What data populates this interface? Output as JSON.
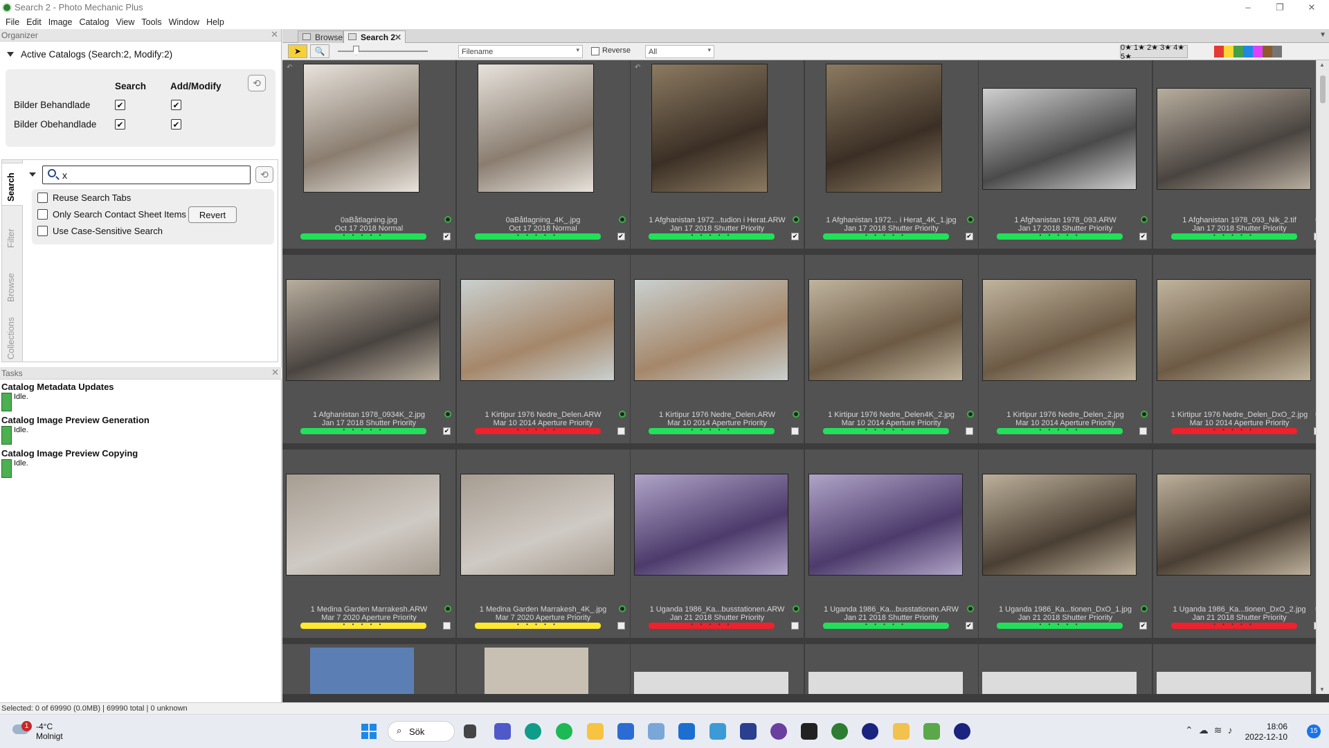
{
  "window": {
    "title": "Search 2 - Photo Mechanic Plus",
    "minimize": "–",
    "restore": "❐",
    "close": "✕"
  },
  "menu": [
    "File",
    "Edit",
    "Image",
    "Catalog",
    "View",
    "Tools",
    "Window",
    "Help"
  ],
  "organizer": {
    "header": "Organizer",
    "active_catalogs": "Active Catalogs (Search:2, Modify:2)",
    "col_search": "Search",
    "col_modify": "Add/Modify",
    "catalogs": [
      {
        "name": "Bilder Behandlade",
        "search": true,
        "modify": true
      },
      {
        "name": "Bilder Obehandlade",
        "search": true,
        "modify": true
      }
    ]
  },
  "side_tabs": [
    "Search",
    "Filter",
    "Browse",
    "Collections"
  ],
  "search": {
    "query": "x",
    "options": [
      {
        "label": "Reuse Search Tabs",
        "checked": false
      },
      {
        "label": "Only Search Contact Sheet Items",
        "checked": false
      },
      {
        "label": "Use Case-Sensitive Search",
        "checked": false
      }
    ],
    "revert_label": "Revert"
  },
  "tasks": {
    "header": "Tasks",
    "items": [
      {
        "title": "Catalog Metadata Updates",
        "status": "Idle."
      },
      {
        "title": "Catalog Image Preview Generation",
        "status": "Idle."
      },
      {
        "title": "Catalog Image Preview Copying",
        "status": "Idle."
      }
    ]
  },
  "tabs": [
    {
      "label": "Browse",
      "active": false
    },
    {
      "label": "Search 2",
      "active": true,
      "close": "✕"
    }
  ],
  "toolbar": {
    "sort_field": "Filename",
    "reverse_label": "Reverse",
    "filter_value": "All",
    "stars": "0★ 1★ 2★ 3★ 4★ 5★",
    "color_labels": [
      "#e53935",
      "#fdd835",
      "#43a047",
      "#1e88e5",
      "#e040fb",
      "#8e5a2b",
      "#757575"
    ]
  },
  "thumbnails": [
    {
      "caption1": "0aBåtlagning.jpg",
      "caption2": "Oct 17 2018 Normal",
      "label": "green",
      "tagged": true
    },
    {
      "caption1": "0aBåtlagning_4K_.jpg",
      "caption2": "Oct 17 2018 Normal",
      "label": "green",
      "tagged": true
    },
    {
      "caption1": "1 Afghanistan 1972...tudion i Herat.ARW",
      "caption2": "Jan 17 2018 Shutter Priority",
      "label": "green",
      "tagged": true
    },
    {
      "caption1": "1 Afghanistan 1972... i Herat_4K_1.jpg",
      "caption2": "Jan 17 2018 Shutter Priority",
      "label": "green",
      "tagged": true
    },
    {
      "caption1": "1 Afghanistan 1978_093.ARW",
      "caption2": "Jan 17 2018 Shutter Priority",
      "label": "green",
      "tagged": true
    },
    {
      "caption1": "1 Afghanistan 1978_093_Nik_2.tif",
      "caption2": "Jan 17 2018 Shutter Priority",
      "label": "green",
      "tagged": false
    },
    {
      "caption1": "1 Afghanistan 1978_0934K_2.jpg",
      "caption2": "Jan 17 2018 Shutter Priority",
      "label": "green",
      "tagged": true
    },
    {
      "caption1": "1 Kirtipur 1976 Nedre_Delen.ARW",
      "caption2": "Mar 10 2014 Aperture Priority",
      "label": "red",
      "tagged": false
    },
    {
      "caption1": "1 Kirtipur 1976 Nedre_Delen.ARW",
      "caption2": "Mar 10 2014 Aperture Priority",
      "label": "green",
      "tagged": false
    },
    {
      "caption1": "1 Kirtipur 1976 Nedre_Delen4K_2.jpg",
      "caption2": "Mar 10 2014 Aperture Priority",
      "label": "green",
      "tagged": false
    },
    {
      "caption1": "1 Kirtipur 1976 Nedre_Delen_2.jpg",
      "caption2": "Mar 10 2014 Aperture Priority",
      "label": "green",
      "tagged": false
    },
    {
      "caption1": "1 Kirtipur 1976 Nedre_Delen_DxO_2.jpg",
      "caption2": "Mar 10 2014 Aperture Priority",
      "label": "red",
      "tagged": false
    },
    {
      "caption1": "1 Medina Garden Marrakesh.ARW",
      "caption2": "Mar 7 2020 Aperture Priority",
      "label": "yellow",
      "tagged": false
    },
    {
      "caption1": "1 Medina Garden Marrakesh_4K_.jpg",
      "caption2": "Mar 7 2020 Aperture Priority",
      "label": "yellow",
      "tagged": false
    },
    {
      "caption1": "1 Uganda 1986_Ka...busstationen.ARW",
      "caption2": "Jan 21 2018 Shutter Priority",
      "label": "red",
      "tagged": false
    },
    {
      "caption1": "1 Uganda 1986_Ka...busstationen.ARW",
      "caption2": "Jan 21 2018 Shutter Priority",
      "label": "green",
      "tagged": true
    },
    {
      "caption1": "1 Uganda 1986_Ka...tionen_DxO_1.jpg",
      "caption2": "Jan 21 2018 Shutter Priority",
      "label": "green",
      "tagged": true
    },
    {
      "caption1": "1 Uganda 1986_Ka...tionen_DxO_2.jpg",
      "caption2": "Jan 21 2018 Shutter Priority",
      "label": "red",
      "tagged": false
    }
  ],
  "status": "Selected: 0 of 69990 (0.0MB) | 69990 total | 0 unknown",
  "taskbar": {
    "weather_temp": "-4°C",
    "weather_desc": "Molnigt",
    "notifications": "1",
    "search_label": "Sök",
    "time": "18:06",
    "date": "2022-12-10",
    "badge": "15"
  }
}
